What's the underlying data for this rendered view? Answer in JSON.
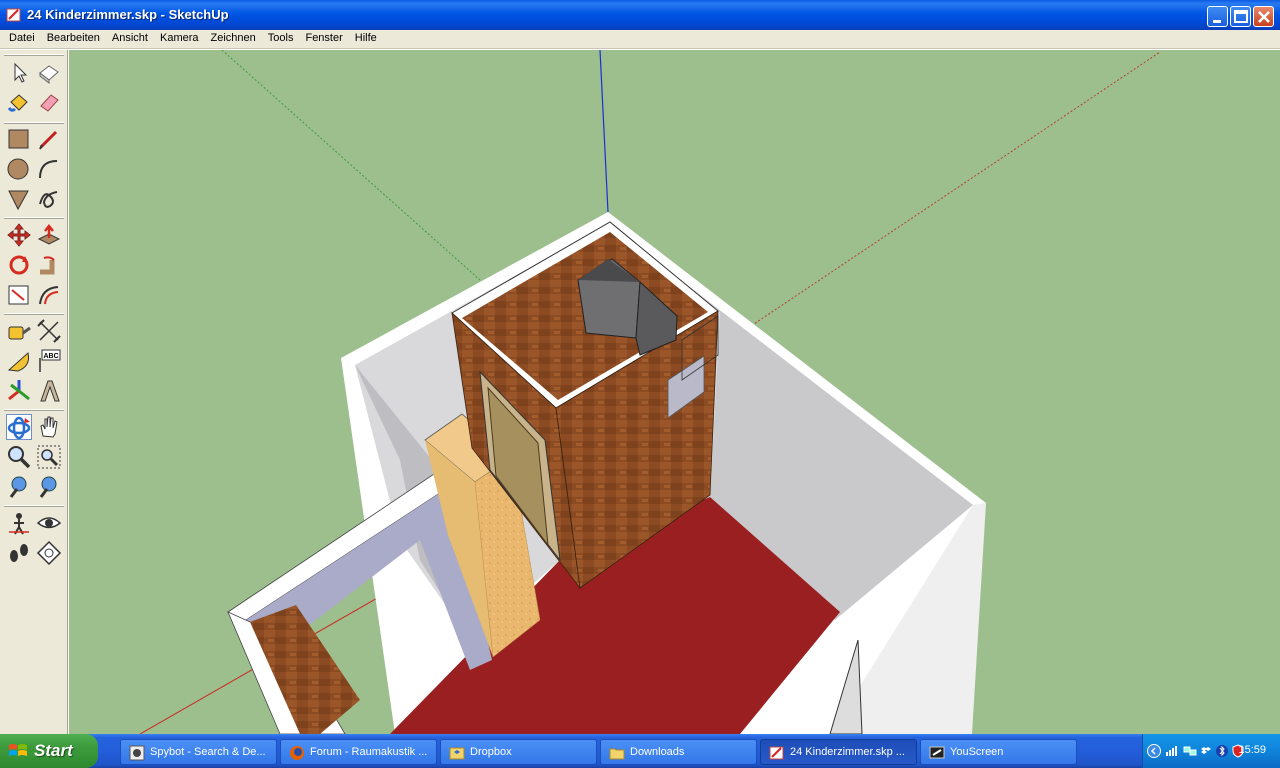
{
  "window": {
    "title": "24 Kinderzimmer.skp - SketchUp"
  },
  "menu": [
    "Datei",
    "Bearbeiten",
    "Ansicht",
    "Kamera",
    "Zeichnen",
    "Tools",
    "Fenster",
    "Hilfe"
  ],
  "tools": [
    "select-tool-icon",
    "make-component-icon",
    "paint-bucket-icon",
    "eraser-icon",
    "rectangle-icon",
    "line-icon",
    "circle-icon",
    "arc-icon",
    "polygon-icon",
    "freehand-icon",
    "move-icon",
    "push-pull-icon",
    "rotate-icon",
    "follow-me-icon",
    "scale-icon",
    "offset-icon",
    "tape-measure-icon",
    "dimension-icon",
    "protractor-icon",
    "text-icon",
    "axes-icon",
    "3d-text-icon",
    "orbit-icon",
    "pan-icon",
    "zoom-icon",
    "zoom-window-icon",
    "previous-view-icon",
    "next-view-icon",
    "position-camera-icon",
    "look-around-icon",
    "walk-icon",
    "section-plane-icon"
  ],
  "toolbar_labels": {
    "text_tool": "ABC"
  },
  "taskbar": {
    "start_label": "Start",
    "tasks": [
      {
        "label": "Spybot - Search & De...",
        "icon": "spybot-icon",
        "active": false
      },
      {
        "label": "Forum - Raumakustik ...",
        "icon": "firefox-icon",
        "active": false
      },
      {
        "label": "Dropbox",
        "icon": "dropbox-folder-icon",
        "active": false
      },
      {
        "label": "Downloads",
        "icon": "folder-icon",
        "active": false
      },
      {
        "label": "24 Kinderzimmer.skp ...",
        "icon": "sketchup-icon",
        "active": true
      },
      {
        "label": "YouScreen",
        "icon": "youscreen-icon",
        "active": false
      }
    ],
    "clock": "15:59"
  },
  "colors": {
    "sky_ground": "#9dbf8e",
    "floor": "#9a1f21",
    "wall_inner": "#c8c8cc",
    "wood_box": "#8b4a22",
    "xp_blue": "#0055e5"
  }
}
